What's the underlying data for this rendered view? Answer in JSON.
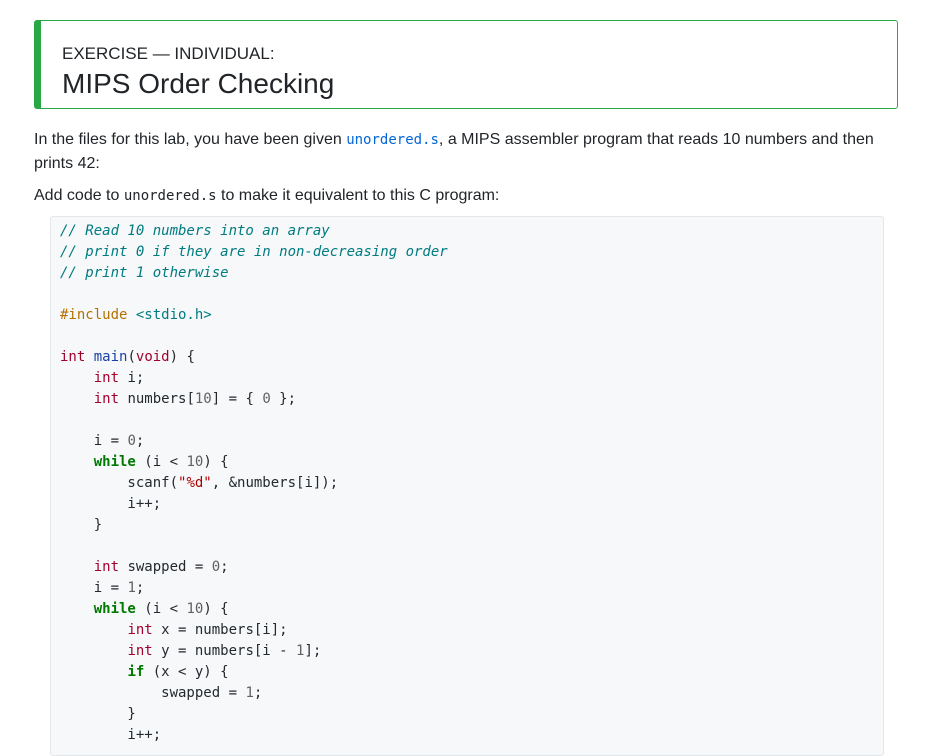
{
  "exercise": {
    "kicker": "EXERCISE — INDIVIDUAL:",
    "title": "MIPS Order Checking"
  },
  "intro": {
    "text_before": "In the files for this lab, you have been given ",
    "file_link": "unordered.s",
    "text_after": ", a MIPS assembler program that reads 10 numbers and then prints 42:"
  },
  "task": {
    "text_before": "Add code to ",
    "file_name": "unordered.s",
    "text_after": " to make it equivalent to this C program:"
  },
  "code": {
    "lines": [
      [
        [
          "comment",
          "// Read 10 numbers into an array"
        ]
      ],
      [
        [
          "comment",
          "// print 0 if they are in non-decreasing order"
        ]
      ],
      [
        [
          "comment",
          "// print 1 otherwise"
        ]
      ],
      [],
      [
        [
          "preproc",
          "#include "
        ],
        [
          "include",
          "<stdio.h>"
        ]
      ],
      [],
      [
        [
          "keyword",
          "int"
        ],
        [
          "plain",
          " "
        ],
        [
          "func",
          "main"
        ],
        [
          "plain",
          "("
        ],
        [
          "keyword",
          "void"
        ],
        [
          "plain",
          ") {"
        ]
      ],
      [
        [
          "plain",
          "    "
        ],
        [
          "keyword",
          "int"
        ],
        [
          "plain",
          " i;"
        ]
      ],
      [
        [
          "plain",
          "    "
        ],
        [
          "keyword",
          "int"
        ],
        [
          "plain",
          " numbers["
        ],
        [
          "number",
          "10"
        ],
        [
          "plain",
          "] = { "
        ],
        [
          "number",
          "0"
        ],
        [
          "plain",
          " };"
        ]
      ],
      [],
      [
        [
          "plain",
          "    i = "
        ],
        [
          "number",
          "0"
        ],
        [
          "plain",
          ";"
        ]
      ],
      [
        [
          "plain",
          "    "
        ],
        [
          "kwbold",
          "while"
        ],
        [
          "plain",
          " (i < "
        ],
        [
          "number",
          "10"
        ],
        [
          "plain",
          ") {"
        ]
      ],
      [
        [
          "plain",
          "        scanf("
        ],
        [
          "string",
          "\"%d\""
        ],
        [
          "plain",
          ", &numbers[i]);"
        ]
      ],
      [
        [
          "plain",
          "        i++;"
        ]
      ],
      [
        [
          "plain",
          "    }"
        ]
      ],
      [],
      [
        [
          "plain",
          "    "
        ],
        [
          "keyword",
          "int"
        ],
        [
          "plain",
          " swapped = "
        ],
        [
          "number",
          "0"
        ],
        [
          "plain",
          ";"
        ]
      ],
      [
        [
          "plain",
          "    i = "
        ],
        [
          "number",
          "1"
        ],
        [
          "plain",
          ";"
        ]
      ],
      [
        [
          "plain",
          "    "
        ],
        [
          "kwbold",
          "while"
        ],
        [
          "plain",
          " (i < "
        ],
        [
          "number",
          "10"
        ],
        [
          "plain",
          ") {"
        ]
      ],
      [
        [
          "plain",
          "        "
        ],
        [
          "keyword",
          "int"
        ],
        [
          "plain",
          " x = numbers[i];"
        ]
      ],
      [
        [
          "plain",
          "        "
        ],
        [
          "keyword",
          "int"
        ],
        [
          "plain",
          " y = numbers[i - "
        ],
        [
          "number",
          "1"
        ],
        [
          "plain",
          "];"
        ]
      ],
      [
        [
          "plain",
          "        "
        ],
        [
          "kwbold",
          "if"
        ],
        [
          "plain",
          " (x < y) {"
        ]
      ],
      [
        [
          "plain",
          "            swapped = "
        ],
        [
          "number",
          "1"
        ],
        [
          "plain",
          ";"
        ]
      ],
      [
        [
          "plain",
          "        }"
        ]
      ],
      [
        [
          "plain",
          "        i++;"
        ]
      ]
    ]
  }
}
